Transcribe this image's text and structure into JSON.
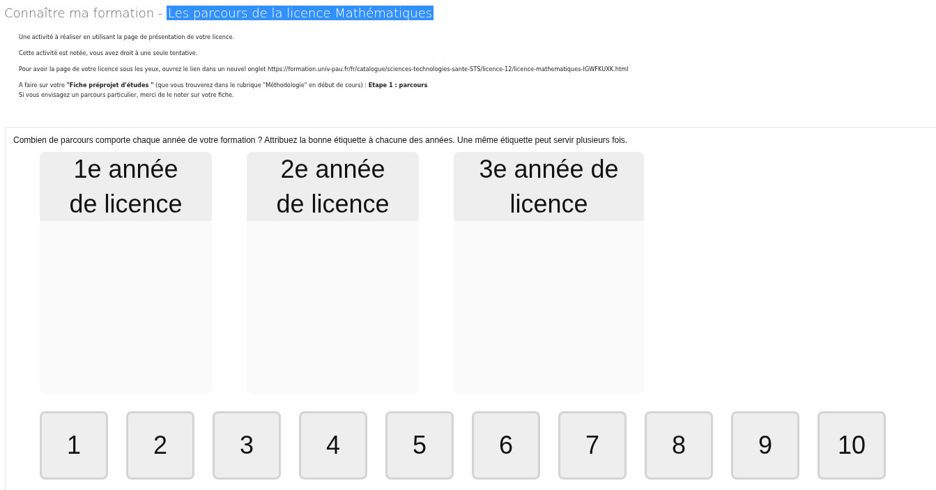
{
  "title": {
    "prefix": "Connaître ma formation - ",
    "highlight": "Les parcours de la licence Mathématiques",
    "highlighted": true
  },
  "intro": [
    {
      "lines": [
        "Une activité à réaliser en utilisant la page de présentation de votre licence."
      ]
    },
    {
      "lines": [
        "Cette activité est notée, vous avez droit à une seule tentative."
      ]
    },
    {
      "lines": [
        "Pour avoir la page de votre licence sous les yeux, ouvrez le lien dans un nouvel onglet https://formation.univ-pau.fr/fr/catalogue/sciences-technologies-sante-STS/licence-12/licence-mathematiques-IGWFKUXK.html"
      ]
    },
    {
      "lines": [
        "A faire sur votre **\"Fiche préprojet d'études \"** (que vous trouverez dans le rubrique \"Méthodologie\" en début de cours) : **Etape 1 : parcours**",
        "Si vous envisagez un parcours particulier, merci de le noter sur votre fiche."
      ]
    }
  ],
  "activity": {
    "question": "Combien de parcours comporte chaque année de votre formation ? Attribuez la bonne étiquette à chacune des années. Une même étiquette peut servir plusieurs fois.",
    "drop_zones": [
      {
        "label": "1e année de licence"
      },
      {
        "label": "2e année de licence"
      },
      {
        "label": "3e année de licence"
      }
    ],
    "labels": [
      "1",
      "2",
      "3",
      "4",
      "5",
      "6",
      "7",
      "8",
      "9",
      "10"
    ]
  }
}
